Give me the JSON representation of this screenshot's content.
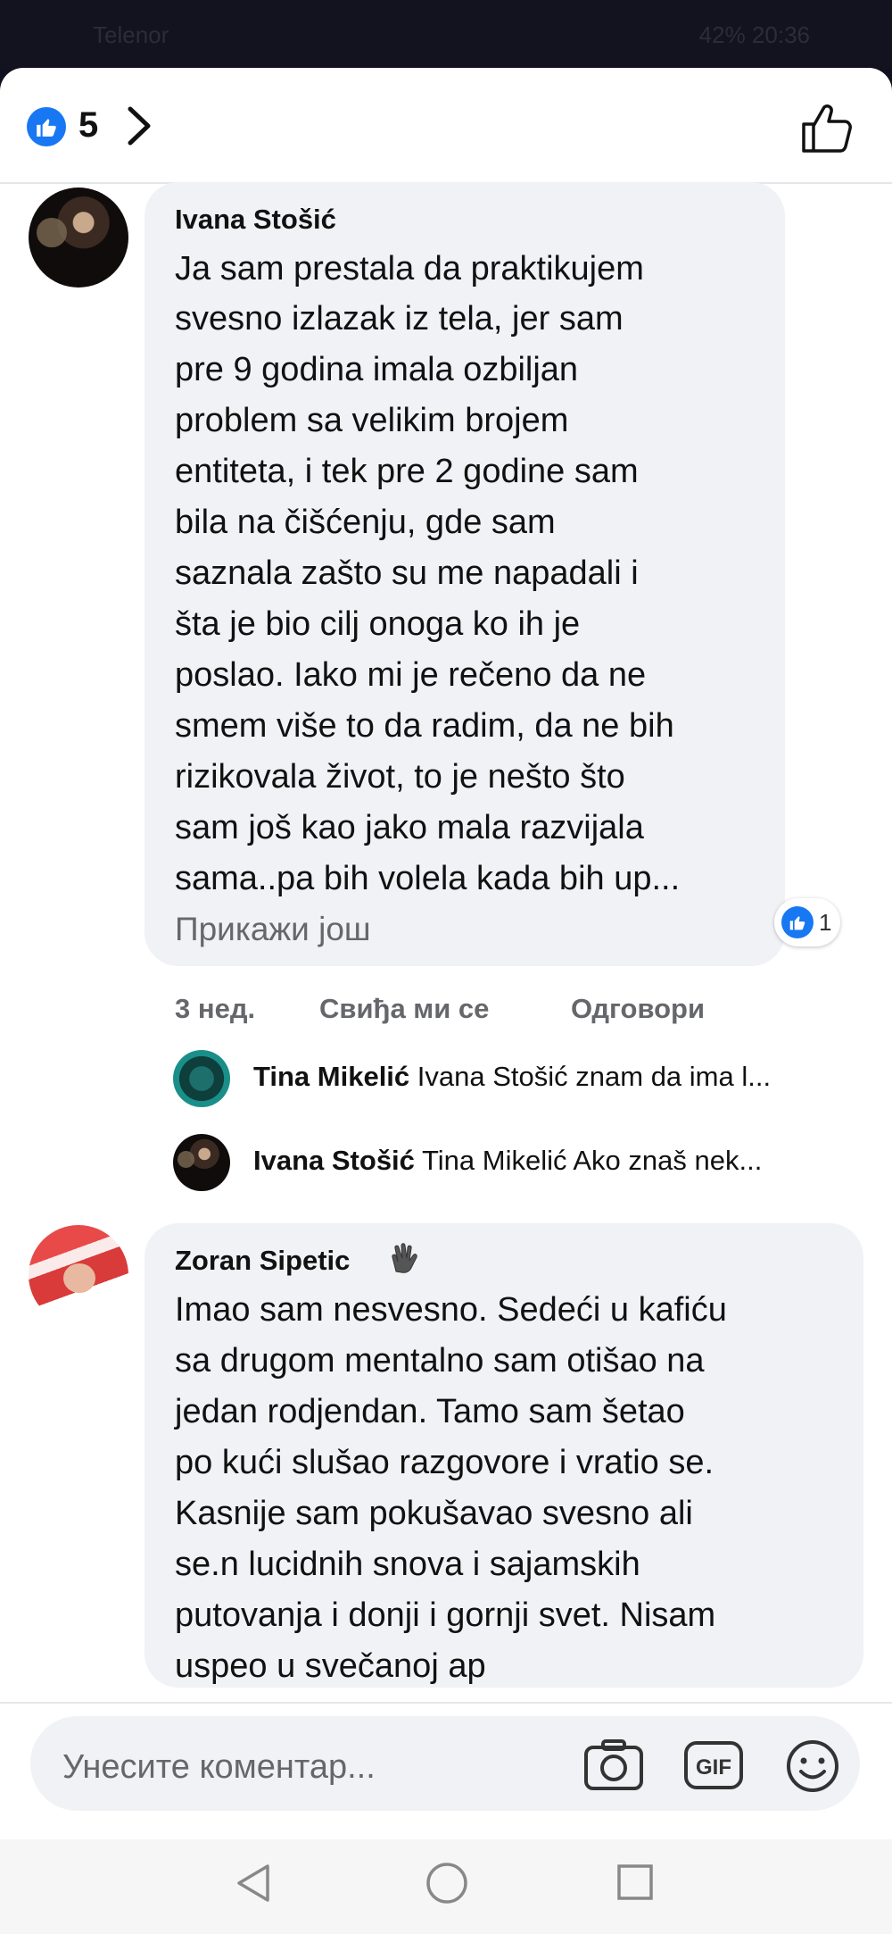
{
  "status_bar": {
    "left": "Telenor",
    "right": "42% 20:36"
  },
  "header": {
    "likes_count": "5",
    "like_icon": "like-icon",
    "thumb_icon": "thumbs-up-outline-icon",
    "accent": "#1877f2"
  },
  "comments": [
    {
      "author": "Ivana Stošić",
      "lines": [
        "Ja sam prestala da praktikujem",
        "svesno izlazak iz tela, jer sam",
        "pre 9 godina imala ozbiljan",
        "problem sa velikim brojem",
        "entiteta, i tek pre 2 godine sam",
        "bila na čišćenju, gde sam",
        "saznala zašto su me napadali i",
        "šta je bio cilj onoga ko ih je",
        "poslao. Iako mi je rečeno da ne",
        "smem više to da radim, da ne bih",
        "rizikovala život, to je nešto što",
        "sam još kao jako mala razvijala",
        "sama..pa bih volela kada bih up..."
      ],
      "see_more": "Прикажи још",
      "reaction_count": "1",
      "time": "3 нед.",
      "like_label": "Свиђа ми се",
      "reply_label": "Одговори",
      "replies": [
        {
          "name": "Tina Mikelić",
          "text": "Ivana Stošić znam da ima l..."
        },
        {
          "name": "Ivana Stošić",
          "text": "Tina Mikelić Ako znaš nek..."
        }
      ]
    },
    {
      "author": "Zoran Sipetic",
      "badge_icon": "waving-hand-icon",
      "lines": [
        "Imao sam nesvesno. Sedeći u kafiću",
        "sa drugom mentalno sam otišao na",
        "jedan rodjendan.  Tamo sam šetao",
        "po kući slušao razgovore i vratio se.",
        "Kasnije sam pokušavao svesno ali",
        "se.n lucidnih snova i sajamskih",
        "putovanja i donji i gornji svet. Nisam",
        "uspeo u svečanoj ap"
      ]
    }
  ],
  "composer": {
    "placeholder": "Унесите коментар...",
    "icons": [
      "camera-icon",
      "gif-icon",
      "emoji-icon"
    ]
  },
  "nav": {
    "icons": [
      "back-icon",
      "home-icon",
      "recents-icon"
    ]
  }
}
